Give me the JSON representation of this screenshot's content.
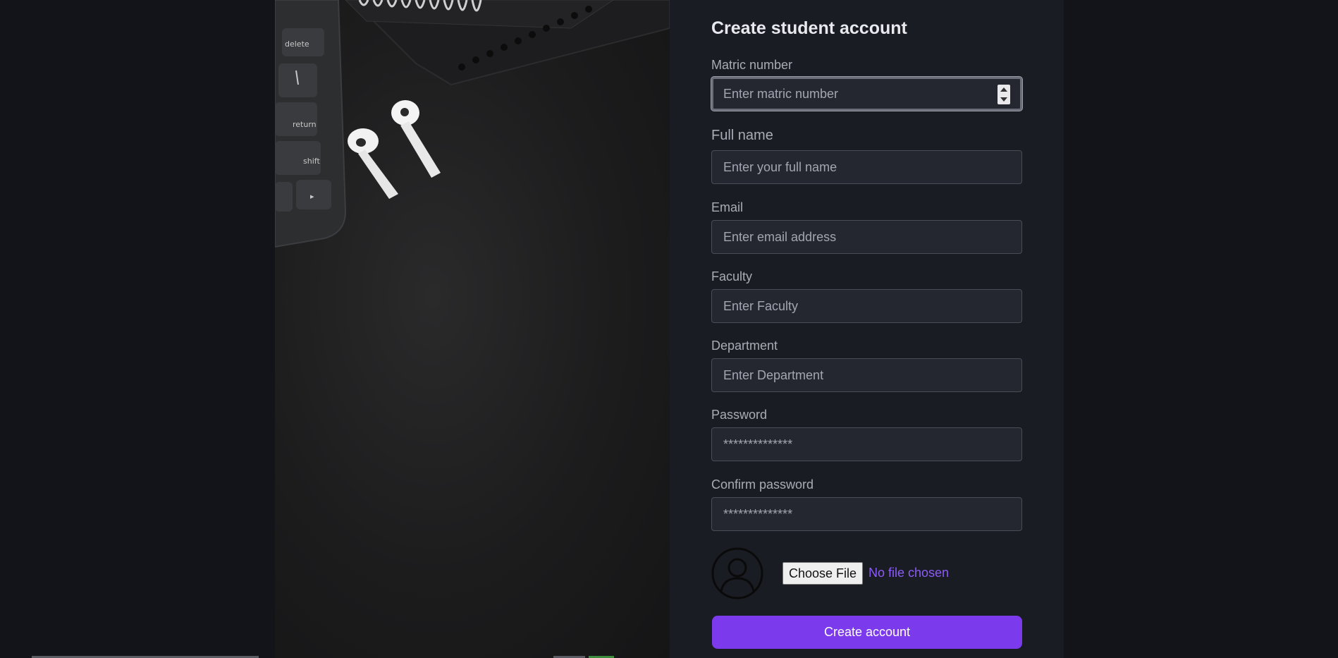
{
  "form": {
    "title": "Create student account",
    "fields": [
      {
        "label": "Matric number",
        "placeholder": "Enter matric number",
        "type": "number"
      },
      {
        "label": "Full name",
        "placeholder": "Enter your full name",
        "type": "text"
      },
      {
        "label": "Email",
        "placeholder": "Enter email address",
        "type": "email"
      },
      {
        "label": "Faculty",
        "placeholder": "Enter Faculty",
        "type": "text"
      },
      {
        "label": "Department",
        "placeholder": "Enter Department",
        "type": "text"
      },
      {
        "label": "Password",
        "placeholder": "**************",
        "type": "password"
      },
      {
        "label": "Confirm password",
        "placeholder": "**************",
        "type": "password"
      }
    ],
    "file_button_label": "Choose File",
    "file_status": "No file chosen",
    "submit_label": "Create account"
  },
  "photo": {
    "key_labels": [
      "delete",
      "return",
      "shift",
      "▸"
    ]
  },
  "colors": {
    "background": "#13141a",
    "panel": "#1a1c23",
    "accent": "#7c3aed",
    "link": "#8b5cf6"
  }
}
